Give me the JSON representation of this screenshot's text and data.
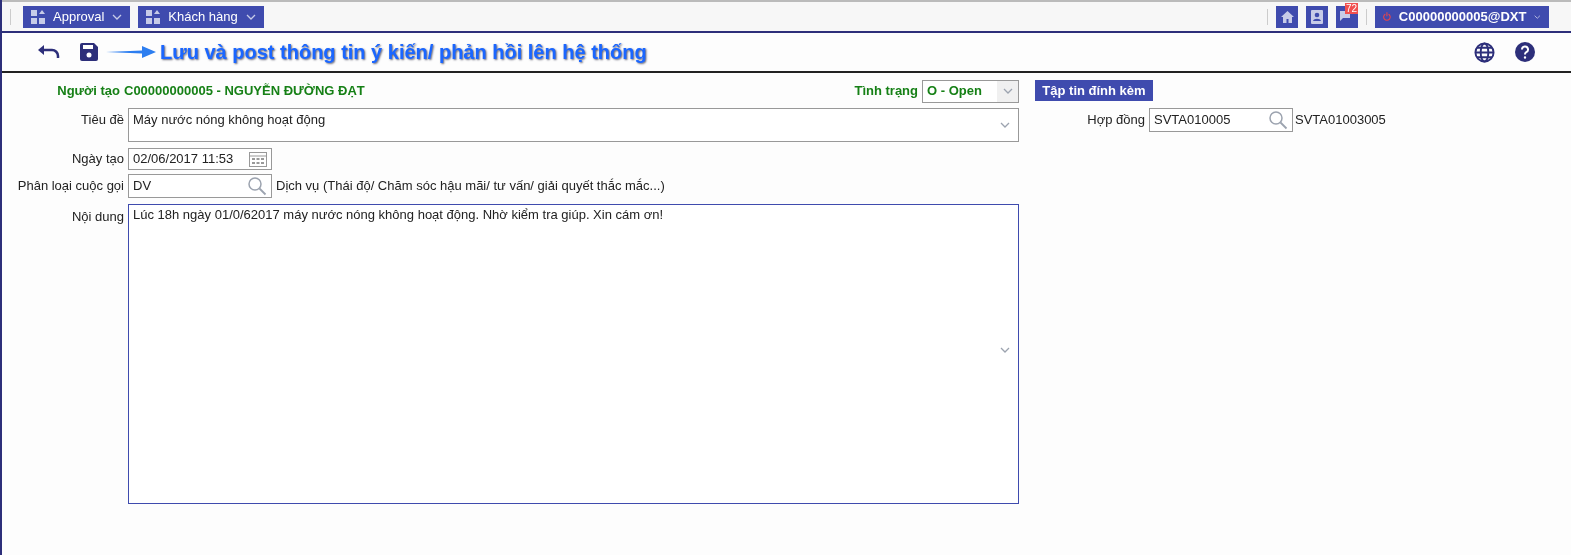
{
  "top_bar": {
    "menus": [
      {
        "label": "Approval"
      },
      {
        "label": "Khách hàng"
      }
    ],
    "notification_count": "72",
    "user": "C00000000005@DXT"
  },
  "toolbar": {
    "annotation": "Lưu và post thông tin ý kiến/ phản hồi lên hệ thống"
  },
  "form": {
    "creator_label": "Người tạo",
    "creator": "C00000000005 - NGUYỄN ĐƯỜNG ĐẠT",
    "status_label": "Tình trạng",
    "status": "O - Open",
    "title_label": "Tiêu đề",
    "title": "Máy nước nóng không hoạt động",
    "date_label": "Ngày tạo",
    "date": "02/06/2017 11:53",
    "category_label": "Phân loại cuộc gọi",
    "category": "DV",
    "category_desc": "Dịch vụ (Thái độ/ Chăm sóc hậu mãi/ tư vấn/ giải quyết thắc mắc...)",
    "content_label": "Nội dung",
    "content": "Lúc 18h ngày 01/0/62017 máy nước nóng không hoạt động. Nhờ kiểm tra giúp. Xin cám ơn!",
    "attach_button": "Tập tin đính kèm",
    "contract_label": "Hợp đồng",
    "contract": "SVTA010005",
    "contract_desc": "SVTA01003005"
  }
}
